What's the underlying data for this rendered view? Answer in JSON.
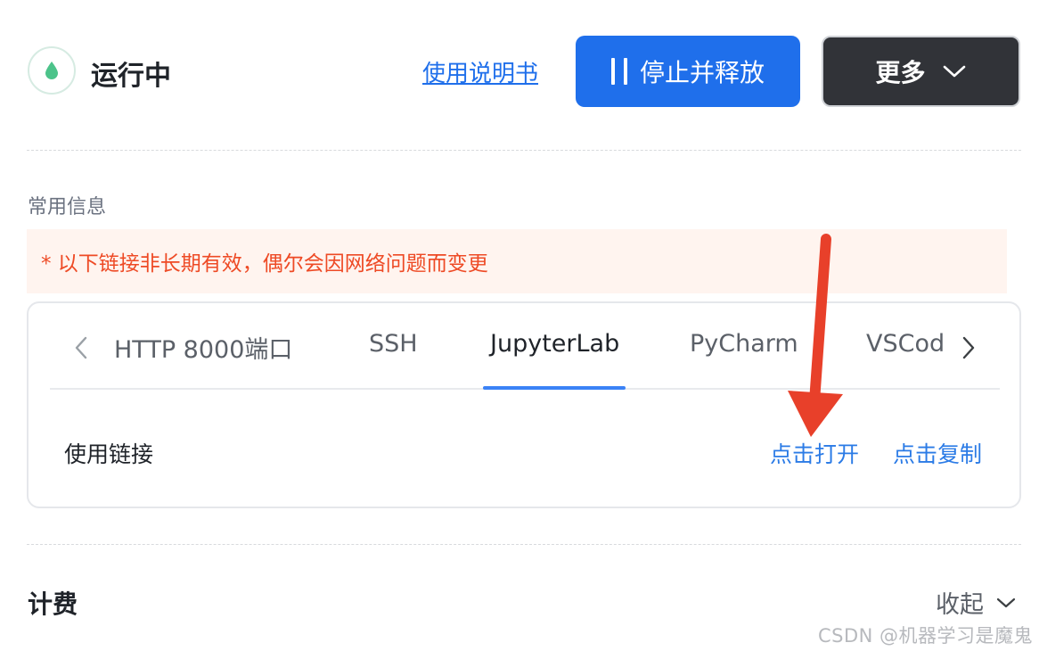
{
  "header": {
    "status_text": "运行中",
    "status_icon": "droplet-icon",
    "status_color": "#4cc38a",
    "manual_link": "使用说明书",
    "stop_button": "停止并释放",
    "more_button": "更多"
  },
  "section": {
    "title": "常用信息",
    "notice": "* 以下链接非长期有效，偶尔会因网络问题而变更"
  },
  "tabs": {
    "items": [
      {
        "label": "HTTP 8000端口"
      },
      {
        "label": "SSH"
      },
      {
        "label": "JupyterLab"
      },
      {
        "label": "PyCharm"
      },
      {
        "label": "VSCode"
      }
    ],
    "active_index": 2
  },
  "link_row": {
    "label": "使用链接",
    "open_action": "点击打开",
    "copy_action": "点击复制"
  },
  "billing": {
    "title": "计费",
    "collapse_label": "收起"
  },
  "watermark": "CSDN @机器学习是魔鬼",
  "colors": {
    "primary": "#1f6feb",
    "link": "#2b7be6",
    "notice_text": "#ee4a25",
    "notice_bg": "#fff4ef",
    "dark_button": "#313338",
    "annotation_arrow": "#e8402a"
  }
}
